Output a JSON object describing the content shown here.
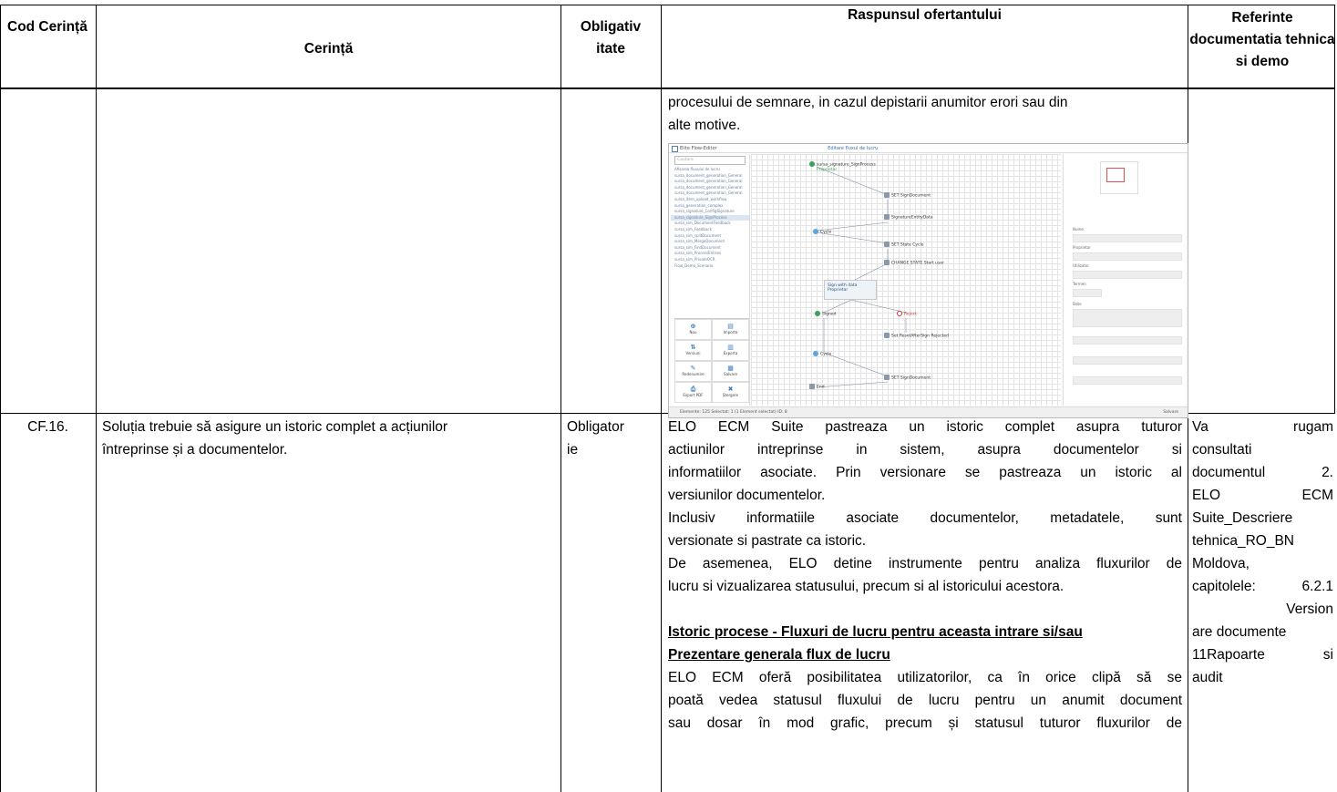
{
  "table": {
    "headers": {
      "code": "Cod Cerință",
      "requirement": "Cerință",
      "mandatory": "Obligativ itate",
      "response": "Raspunsul ofertantului",
      "references": "Referinte documentatia tehnica si demo"
    },
    "continuation": {
      "response_lines": [
        "procesului de semnare, in cazul depistarii anumitor erori sau din",
        "alte motive."
      ]
    },
    "row_cf16": {
      "code": "CF.16.",
      "requirement_lines": [
        "Soluția trebuie să asigure un istoric complet a acțiunilor",
        "întreprinse și a documentelor."
      ],
      "mandatory_lines": [
        "Obligator",
        "ie"
      ],
      "response_lines": [
        "ELO ECM Suite pastreaza un istoric complet asupra tuturor",
        "actiunilor intreprinse in sistem, asupra documentelor si",
        "informatiilor asociate. Prin versionare se pastreaza un istoric al",
        "versiunilor documentelor.",
        "Inclusiv informatiile asociate documentelor, metadatele, sunt",
        "versionate si pastrate ca istoric.",
        "De asemenea, ELO detine instrumente pentru analiza fluxurilor de",
        "lucru si vizualizarea statusului, precum si al istoricului acestora."
      ],
      "section_heading_lines": [
        "Istoric procese - Fluxuri de lucru pentru aceasta intrare si/sau",
        "Prezentare generala flux de lucru"
      ],
      "response_lines_2": [
        "ELO ECM oferă posibilitatea utilizatorilor, ca în orice clipă să se",
        "poată vedea statusul fluxului de lucru pentru un anumit document",
        "sau dosar în mod grafic, precum și statusul tuturor fluxurilor de"
      ],
      "reference_lines": [
        "Va rugam",
        "consultati",
        "documentul 2.",
        "ELO ECM",
        "Suite_Descriere",
        "tehnica_RO_BN",
        "Moldova,",
        "capitolele: 6.2.1",
        "Version",
        "are documente",
        "11Rapoarte si",
        "audit"
      ]
    }
  },
  "screenshot": {
    "title": "Elite Flow-Editor",
    "tab": "Editare fluxul de lucru",
    "search_placeholder": "Cautare",
    "list_items": [
      "Afișarea fluxului de lucru",
      "sursa_document_generation_General",
      "sursa_document_generation_General",
      "sursa_document_generation_General",
      "sursa_document_generation_General",
      "sursa_item_upload_workflow",
      "sursa_generation_complex",
      "sursa_signature_ConfigSignature",
      "sursa_signature_SignProcess",
      "sursa_sim_DocumentFeedback",
      "sursa_sim_Feedback",
      "sursa_sim_splitDocument",
      "sursa_sim_MergeDocument",
      "sursa_sim_FindDocument",
      "sursa_sim_ProcessEntries",
      "sursa_sim_PrivateOCR",
      "Flow_Demo_Scenario"
    ],
    "buttons": [
      {
        "icon": "⊕",
        "label": "Nou"
      },
      {
        "icon": "▤",
        "label": "Importa"
      },
      {
        "icon": "⇅",
        "label": "Versiuni"
      },
      {
        "icon": "▥",
        "label": "Exporta"
      },
      {
        "icon": "✎",
        "label": "Redenumire"
      },
      {
        "icon": "▦",
        "label": "Salvare"
      },
      {
        "icon": "⎙",
        "label": "Export PDF"
      },
      {
        "icon": "✖",
        "label": "Ștergere"
      }
    ],
    "nodes": {
      "start": "sursa_signature_SignProcess",
      "start_sub": "Proprietar",
      "set_doc": "SET SignDocument",
      "sign_entity": "SignatureEntityData",
      "cycle1": "Cycle",
      "set_cycle": "SET State Cycle",
      "check": "CHANGE STATE Start user",
      "box_title": "Sign with data",
      "box_sub": "Proprietar",
      "signed": "Signed",
      "reject": "Reject",
      "set_state": "Set ResetAfterSign Rejected",
      "cycle2": "Cycle",
      "set_end": "SET SignDocument",
      "end": "End"
    },
    "right_labels": [
      "Nume",
      "Proprietar",
      "Utilizator",
      "Termen",
      "Date"
    ],
    "status_text": "Elemente: 125 Selectat: 1 (1 Element selectat) ID: 8",
    "status_right": "Salvare"
  }
}
